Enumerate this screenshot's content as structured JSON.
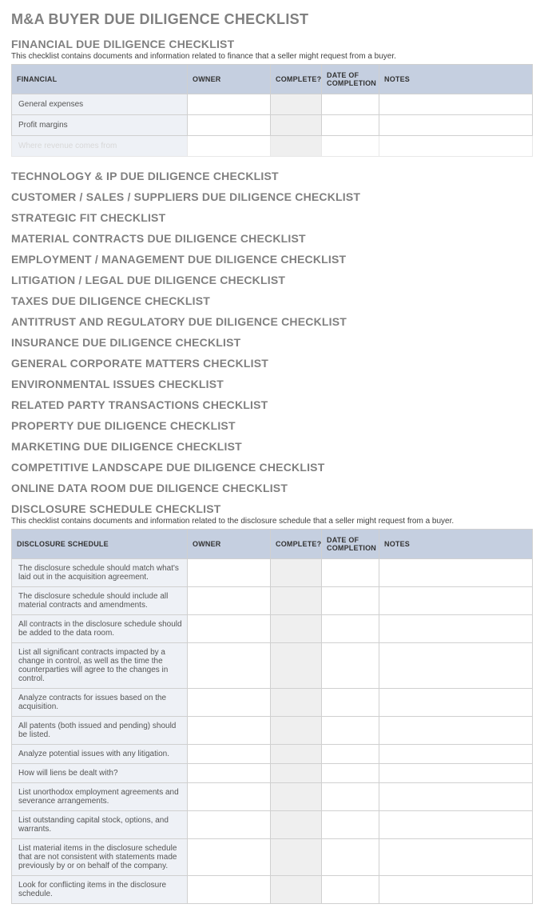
{
  "page_title": "M&A BUYER DUE DILIGENCE CHECKLIST",
  "columns": {
    "owner": "OWNER",
    "complete": "COMPLETE?",
    "date": "DATE OF COMPLETION",
    "notes": "NOTES"
  },
  "financial": {
    "title": "FINANCIAL DUE DILIGENCE CHECKLIST",
    "desc": "This checklist contains documents and information related to finance that a seller might request from a buyer.",
    "header": "FINANCIAL",
    "rows": [
      "General expenses",
      "Profit margins",
      "Where revenue comes from"
    ]
  },
  "middle_sections": [
    "TECHNOLOGY & IP DUE DILIGENCE CHECKLIST",
    "CUSTOMER / SALES / SUPPLIERS DUE DILIGENCE CHECKLIST",
    "STRATEGIC FIT CHECKLIST",
    "MATERIAL CONTRACTS DUE DILIGENCE CHECKLIST",
    "EMPLOYMENT / MANAGEMENT DUE DILIGENCE CHECKLIST",
    "LITIGATION / LEGAL DUE DILIGENCE CHECKLIST",
    "TAXES DUE DILIGENCE CHECKLIST",
    "ANTITRUST AND REGULATORY DUE DILIGENCE CHECKLIST",
    "INSURANCE DUE DILIGENCE CHECKLIST",
    "GENERAL CORPORATE MATTERS CHECKLIST",
    "ENVIRONMENTAL ISSUES CHECKLIST",
    "RELATED PARTY TRANSACTIONS CHECKLIST",
    "PROPERTY DUE DILIGENCE CHECKLIST",
    "MARKETING DUE DILIGENCE CHECKLIST",
    "COMPETITIVE LANDSCAPE DUE DILIGENCE CHECKLIST",
    "ONLINE DATA ROOM DUE DILIGENCE CHECKLIST"
  ],
  "disclosure": {
    "title": "DISCLOSURE SCHEDULE CHECKLIST",
    "desc": "This checklist contains documents and information related to the disclosure schedule that a seller might request from a buyer.",
    "header": "DISCLOSURE SCHEDULE",
    "rows": [
      "The disclosure schedule should match what's laid out in the acquisition agreement.",
      "The disclosure schedule should include all material contracts and amendments.",
      "All contracts in the disclosure schedule should be added to the data room.",
      "List all significant contracts impacted by a change in control, as well as the time the counterparties will agree to the changes in control.",
      "Analyze contracts for issues based on the acquisition.",
      "All patents (both issued and pending) should be listed.",
      "Analyze potential issues with any litigation.",
      "How will liens be dealt with?",
      "List unorthodox employment agreements and severance arrangements.",
      "List outstanding capital stock, options, and warrants.",
      "List material items in the disclosure schedule that are not consistent with statements made previously by or on behalf of the company.",
      "Look for conflicting items in the disclosure schedule."
    ]
  }
}
